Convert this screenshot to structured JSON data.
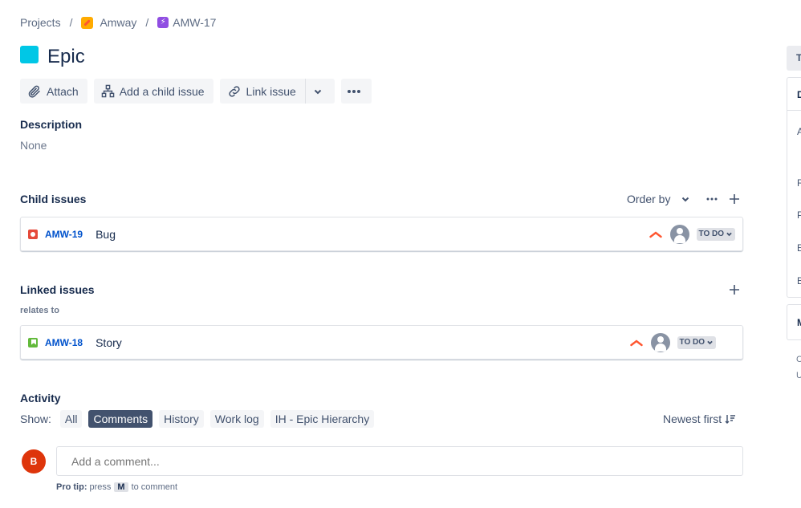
{
  "breadcrumb": {
    "projects": "Projects",
    "sep": "/",
    "project": "Amway",
    "issue_key": "AMW-17"
  },
  "issue": {
    "title": "Epic",
    "type_color": "#00c7e6"
  },
  "toolbar": {
    "attach": "Attach",
    "add_child": "Add a child issue",
    "link_issue": "Link issue"
  },
  "description": {
    "label": "Description",
    "value": "None"
  },
  "child_issues": {
    "label": "Child issues",
    "order_by": "Order by",
    "items": [
      {
        "key": "AMW-19",
        "summary": "Bug",
        "status": "TO DO",
        "type": "bug"
      }
    ]
  },
  "linked_issues": {
    "label": "Linked issues",
    "relation": "relates to",
    "items": [
      {
        "key": "AMW-18",
        "summary": "Story",
        "status": "TO DO",
        "type": "story"
      }
    ]
  },
  "activity": {
    "label": "Activity",
    "show_label": "Show:",
    "filters": [
      "All",
      "Comments",
      "History",
      "Work log",
      "IH - Epic Hierarchy"
    ],
    "active_filter": "Comments",
    "sort": "Newest first",
    "comment_placeholder": "Add a comment...",
    "avatar_initial": "B",
    "protip_label": "Pro tip:",
    "protip_pre": "press",
    "protip_key": "M",
    "protip_post": "to comment"
  },
  "side_panel": {
    "letters": [
      "T",
      "D",
      "A",
      "R",
      "P",
      "E",
      "B",
      "M",
      "C",
      "U"
    ]
  },
  "colors": {
    "link": "#0052cc",
    "priority": "#ff5630",
    "active_filter_bg": "#42526e"
  }
}
